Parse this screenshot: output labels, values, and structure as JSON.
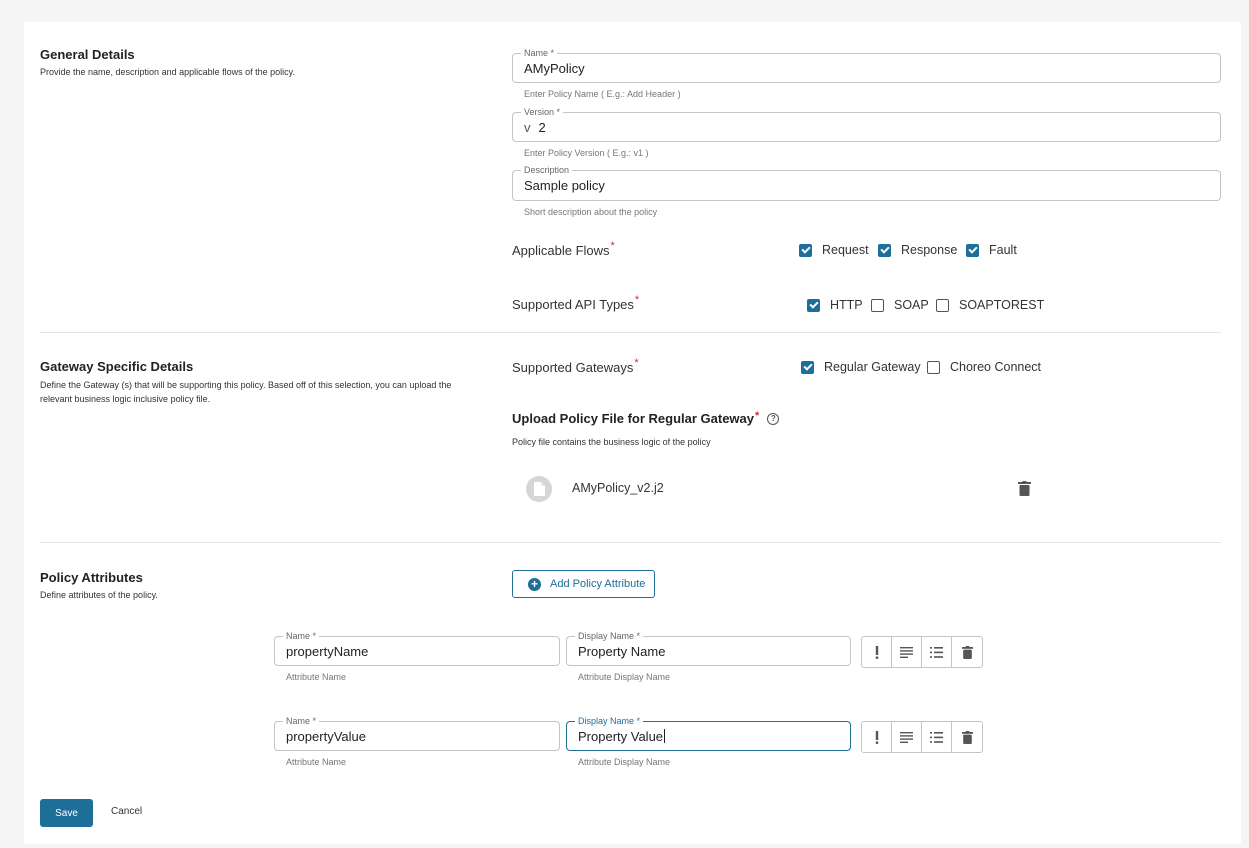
{
  "general": {
    "title": "General Details",
    "desc": "Provide the name, description and applicable flows of the policy.",
    "name_label": "Name *",
    "name_value": "AMyPolicy",
    "name_help": "Enter Policy Name ( E.g.: Add Header )",
    "version_label": "Version *",
    "version_prefix": "v",
    "version_value": "2",
    "version_help": "Enter Policy Version ( E.g.: v1 )",
    "desc_label": "Description",
    "desc_value": "Sample policy",
    "desc_help": "Short description about the policy",
    "flows_label": "Applicable Flows",
    "flows": [
      {
        "label": "Request",
        "checked": true
      },
      {
        "label": "Response",
        "checked": true
      },
      {
        "label": "Fault",
        "checked": true
      }
    ],
    "api_types_label": "Supported API Types",
    "api_types": [
      {
        "label": "HTTP",
        "checked": true
      },
      {
        "label": "SOAP",
        "checked": false
      },
      {
        "label": "SOAPTOREST",
        "checked": false
      }
    ],
    "required_mark": "*"
  },
  "gateway": {
    "title": "Gateway Specific Details",
    "desc": "Define the Gateway (s) that will be supporting this policy. Based off of this selection, you can upload the relevant business logic inclusive policy file.",
    "supported_label": "Supported Gateways",
    "gateways": [
      {
        "label": "Regular Gateway",
        "checked": true
      },
      {
        "label": "Choreo Connect",
        "checked": false
      }
    ],
    "upload_title": "Upload Policy File for Regular Gateway",
    "upload_desc": "Policy file contains the business logic of the policy",
    "file_name": "AMyPolicy_v2.j2"
  },
  "attributes": {
    "title": "Policy Attributes",
    "desc": "Define attributes of the policy.",
    "add_button": "Add Policy Attribute",
    "rows": [
      {
        "name_label": "Name *",
        "name_value": "propertyName",
        "name_help": "Attribute Name",
        "display_label": "Display Name *",
        "display_value": "Property Name",
        "display_help": "Attribute Display Name"
      },
      {
        "name_label": "Name *",
        "name_value": "propertyValue",
        "name_help": "Attribute Name",
        "display_label": "Display Name *",
        "display_value": "Property Value",
        "display_help": "Attribute Display Name"
      }
    ]
  },
  "actions": {
    "save": "Save",
    "cancel": "Cancel"
  },
  "colors": {
    "accent": "#1d6f99",
    "required": "#d32f2f"
  }
}
